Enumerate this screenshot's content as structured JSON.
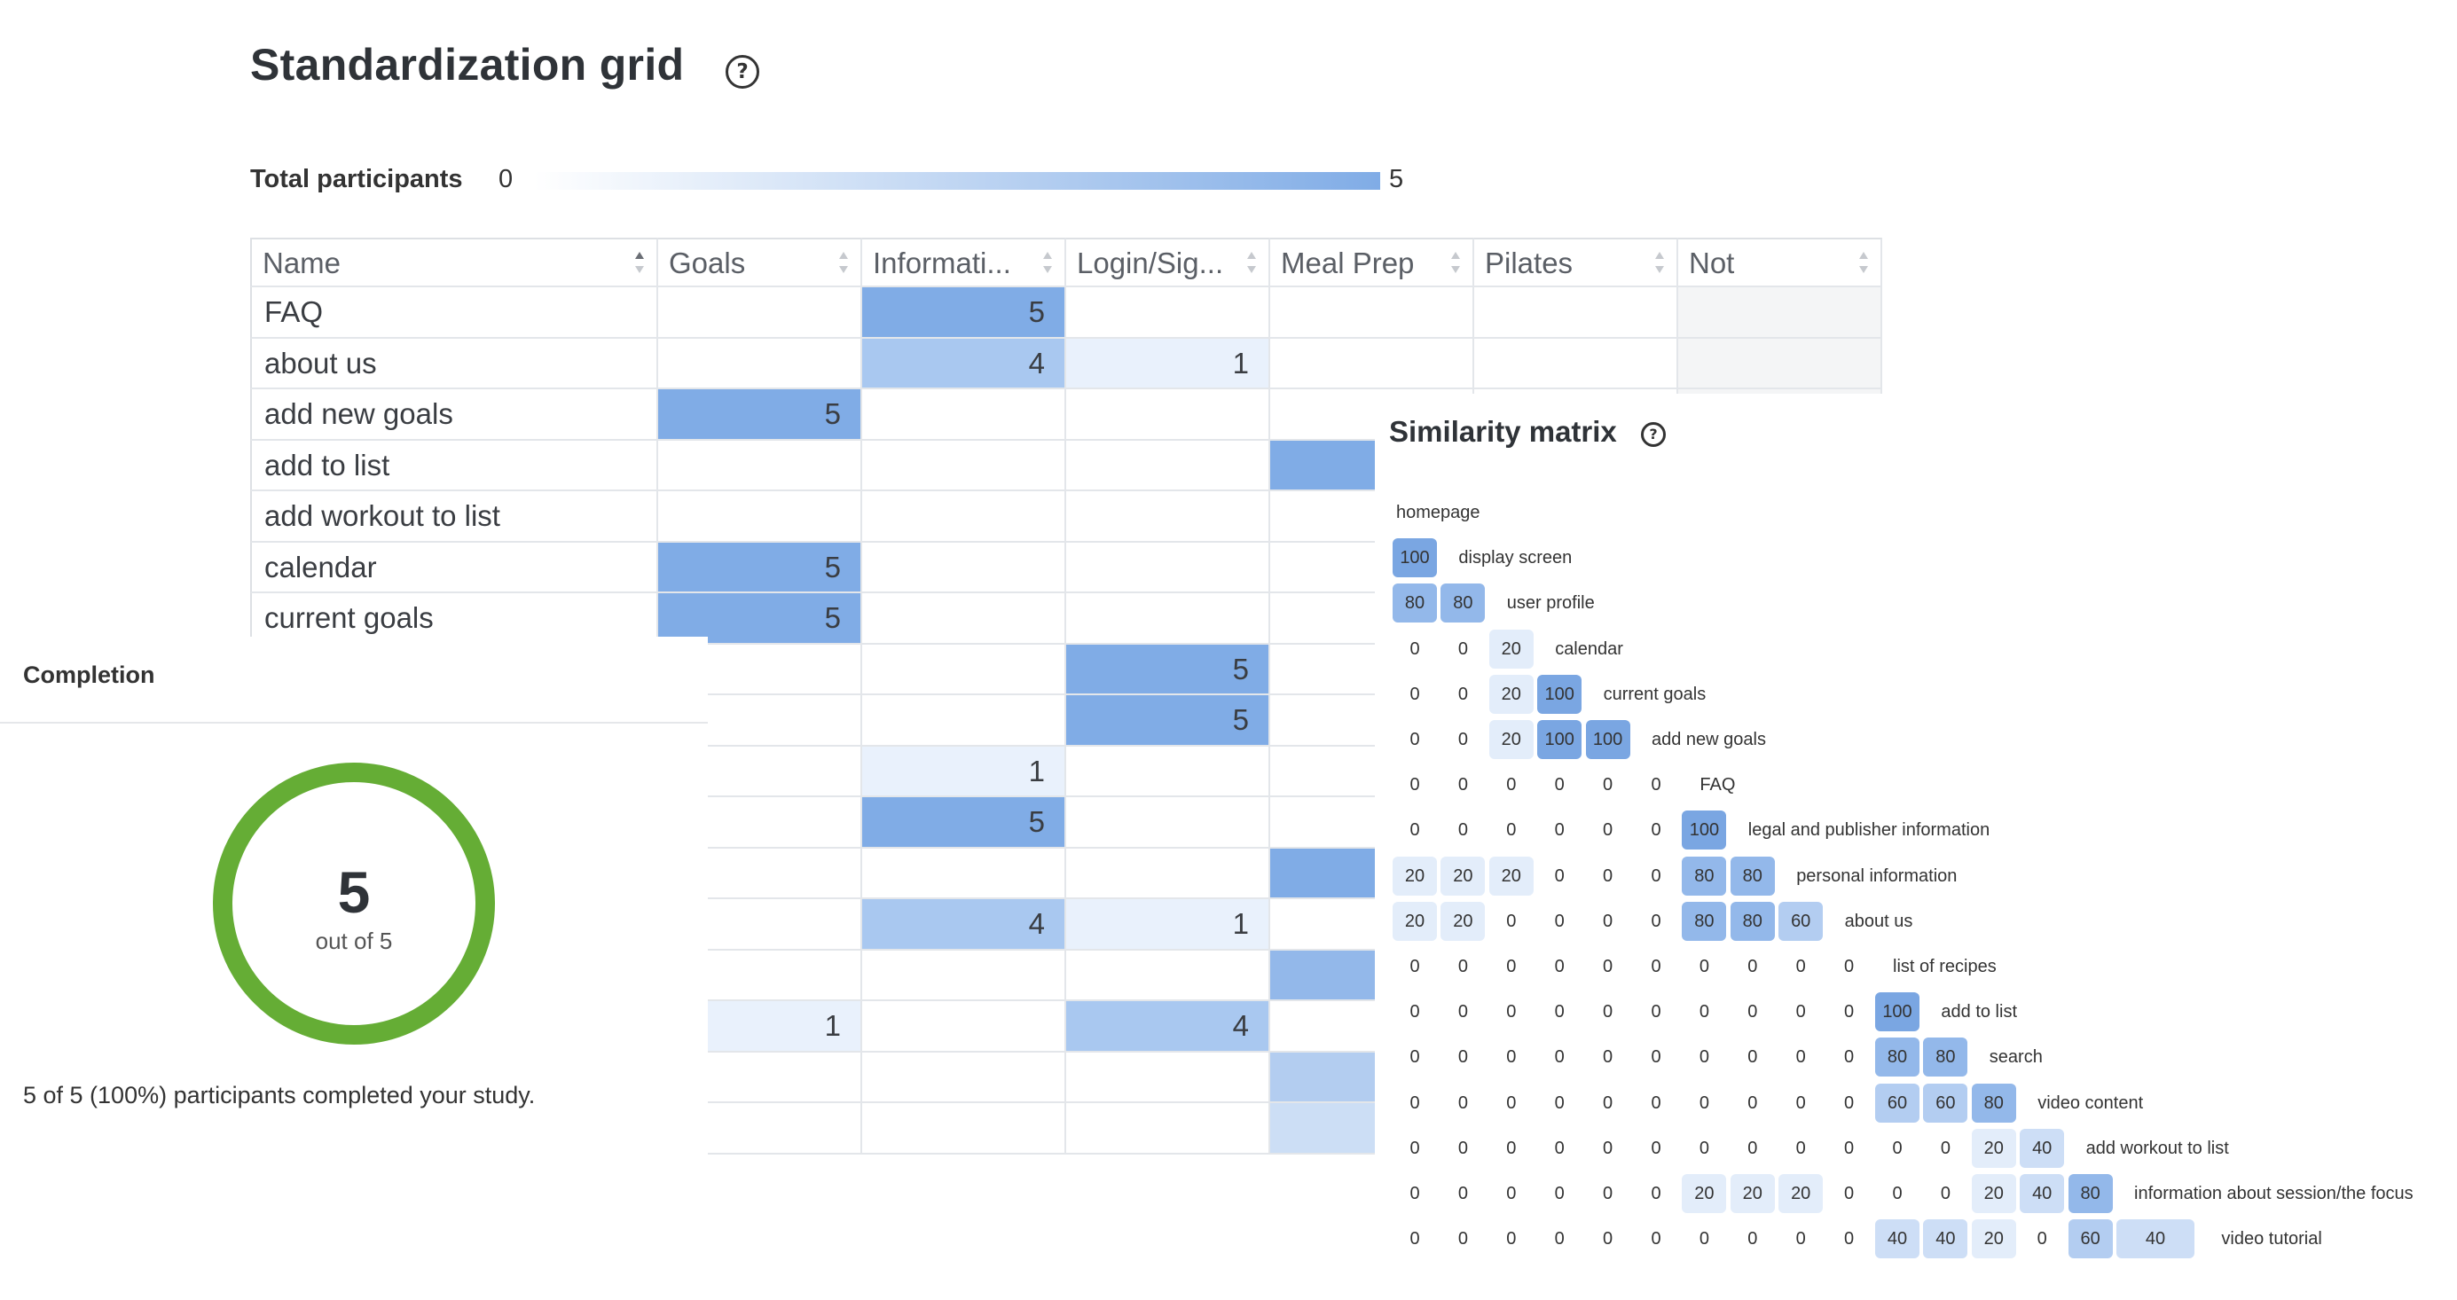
{
  "header": {
    "title": "Standardization grid"
  },
  "total": {
    "label": "Total participants",
    "min": "0",
    "max": "5"
  },
  "grid": {
    "columns": [
      "Name",
      "Goals",
      "Informati...",
      "Login/Sig...",
      "Meal Prep",
      "Pilates",
      "Not standardized"
    ],
    "rows": [
      {
        "name": "FAQ",
        "values": [
          "",
          "5",
          "",
          "",
          "",
          ""
        ]
      },
      {
        "name": "about us",
        "values": [
          "",
          "4",
          "1",
          "",
          "",
          ""
        ]
      },
      {
        "name": "add new goals",
        "values": [
          "5",
          "",
          "",
          "",
          "",
          ""
        ]
      },
      {
        "name": "add to list",
        "values": [
          "",
          "",
          "",
          "",
          "",
          ""
        ]
      },
      {
        "name": "add workout to list",
        "values": [
          "",
          "",
          "",
          "",
          "",
          ""
        ]
      },
      {
        "name": "calendar",
        "values": [
          "5",
          "",
          "",
          "",
          "",
          ""
        ]
      },
      {
        "name": "current goals",
        "values": [
          "5",
          "",
          "",
          "",
          "",
          ""
        ]
      },
      {
        "name": "",
        "values": [
          "",
          "",
          "5",
          "",
          "",
          ""
        ]
      },
      {
        "name": "",
        "values": [
          "",
          "",
          "5",
          "",
          "",
          ""
        ]
      },
      {
        "name": "",
        "values": [
          "",
          "1",
          "",
          "",
          "",
          ""
        ]
      },
      {
        "name": "",
        "values": [
          "",
          "5",
          "",
          "",
          "",
          ""
        ]
      },
      {
        "name": "",
        "values": [
          "",
          "",
          "",
          "",
          "",
          ""
        ]
      },
      {
        "name": "",
        "values": [
          "",
          "4",
          "1",
          "",
          "",
          ""
        ]
      },
      {
        "name": "",
        "values": [
          "",
          "",
          "",
          "",
          "",
          ""
        ]
      },
      {
        "name": "",
        "values": [
          "1",
          "",
          "4",
          "",
          "",
          ""
        ]
      },
      {
        "name": "",
        "values": [
          "",
          "",
          "",
          "",
          "",
          ""
        ]
      },
      {
        "name": "",
        "values": [
          "",
          "",
          "",
          "",
          "",
          ""
        ]
      }
    ],
    "meal_prep_fill": [
      0,
      0,
      0,
      1,
      0,
      0,
      0,
      0,
      0,
      0,
      0,
      1,
      0,
      0.85,
      0,
      0.6,
      0.4
    ],
    "colors": {
      "high": "#80ace6",
      "mid": "#a9c8f0",
      "low": "#e9f1fc"
    }
  },
  "completion": {
    "title": "Completion",
    "count": "5",
    "out_of": "out of 5",
    "summary": "5 of 5 (100%) participants completed your study.",
    "ring_color": "#65ad35"
  },
  "similarity": {
    "title": "Similarity matrix",
    "labels": [
      "homepage",
      "display screen",
      "user profile",
      "calendar",
      "current goals",
      "add new goals",
      "FAQ",
      "legal and publisher information",
      "personal information",
      "about us",
      "list of recipes",
      "add to list",
      "search",
      "video content",
      "add workout to list",
      "information about session/the focus",
      "video tutorial"
    ],
    "rows": [
      [],
      [
        100
      ],
      [
        80,
        80
      ],
      [
        0,
        0,
        20
      ],
      [
        0,
        0,
        20,
        100
      ],
      [
        0,
        0,
        20,
        100,
        100
      ],
      [
        0,
        0,
        0,
        0,
        0,
        0
      ],
      [
        0,
        0,
        0,
        0,
        0,
        0,
        100
      ],
      [
        20,
        20,
        20,
        0,
        0,
        0,
        80,
        80
      ],
      [
        20,
        20,
        0,
        0,
        0,
        0,
        80,
        80,
        60
      ],
      [
        0,
        0,
        0,
        0,
        0,
        0,
        0,
        0,
        0,
        0
      ],
      [
        0,
        0,
        0,
        0,
        0,
        0,
        0,
        0,
        0,
        0,
        100
      ],
      [
        0,
        0,
        0,
        0,
        0,
        0,
        0,
        0,
        0,
        0,
        80,
        80
      ],
      [
        0,
        0,
        0,
        0,
        0,
        0,
        0,
        0,
        0,
        0,
        60,
        60,
        80
      ],
      [
        0,
        0,
        0,
        0,
        0,
        0,
        0,
        0,
        0,
        0,
        0,
        0,
        20,
        40
      ],
      [
        0,
        0,
        0,
        0,
        0,
        0,
        20,
        20,
        20,
        0,
        0,
        0,
        20,
        40,
        80
      ],
      [
        0,
        0,
        0,
        0,
        0,
        0,
        0,
        0,
        0,
        0,
        40,
        40,
        20,
        0,
        60,
        40
      ]
    ]
  }
}
